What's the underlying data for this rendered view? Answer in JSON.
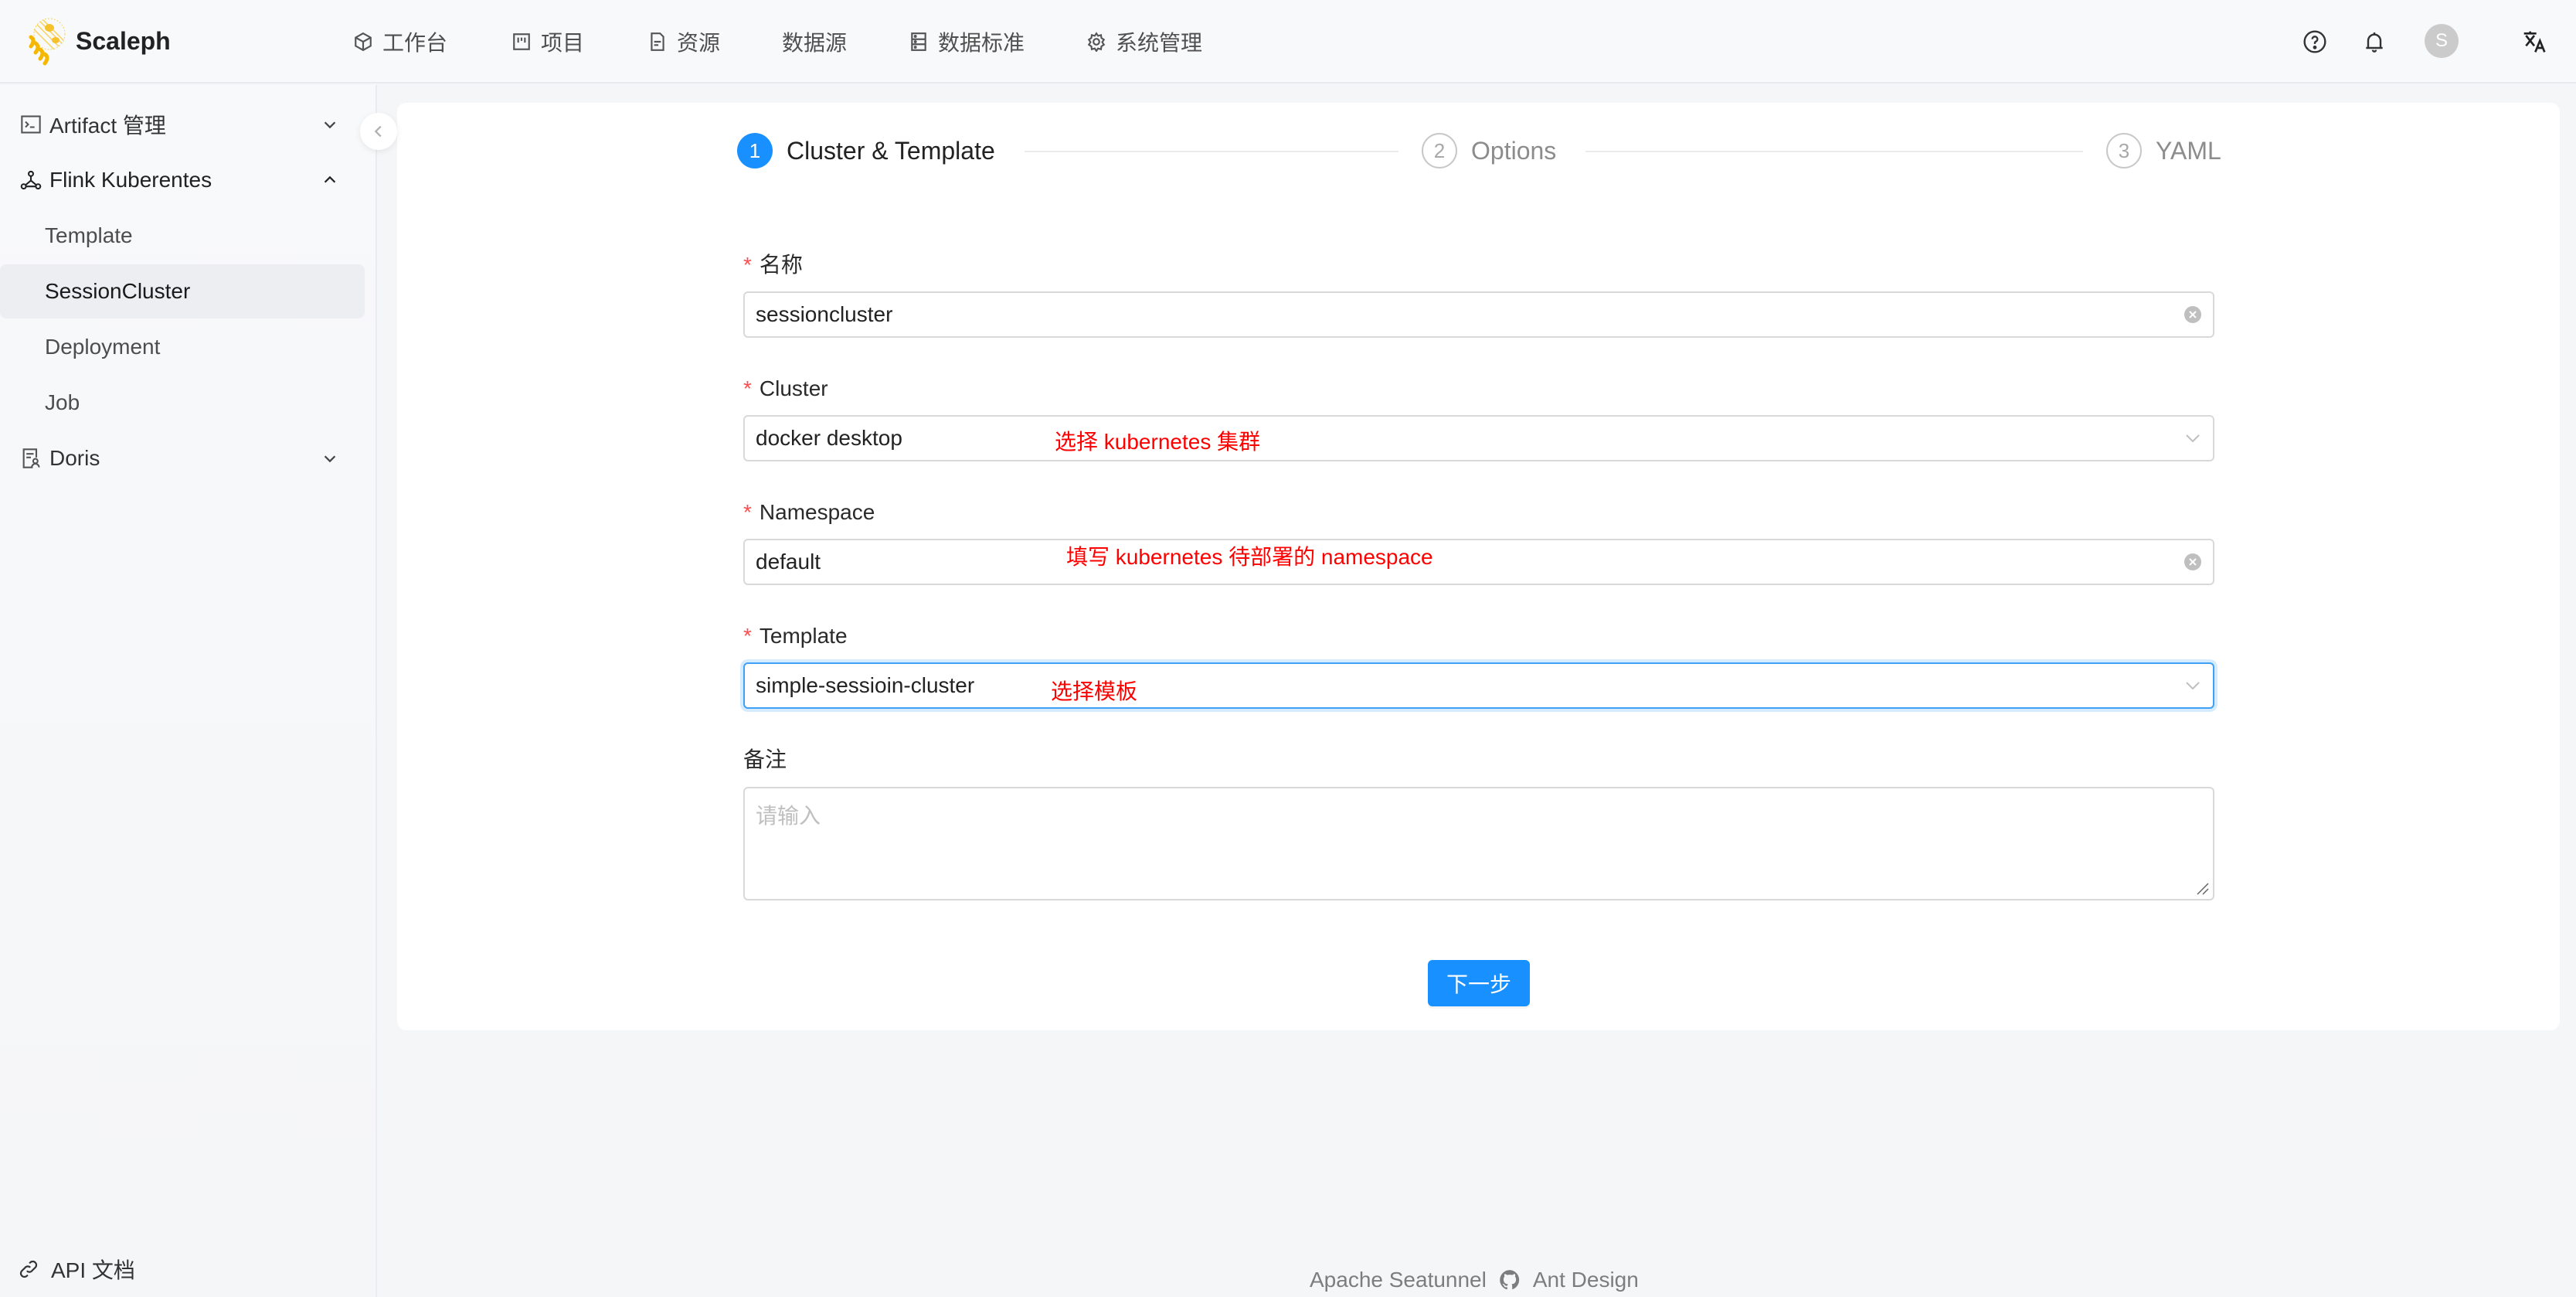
{
  "app": {
    "brand": "Scaleph"
  },
  "header": {
    "nav": [
      {
        "label": "工作台",
        "icon": "cube-icon"
      },
      {
        "label": "项目",
        "icon": "project-icon"
      },
      {
        "label": "资源",
        "icon": "file-icon"
      },
      {
        "label": "数据源",
        "icon": ""
      },
      {
        "label": "数据标准",
        "icon": "database-icon"
      },
      {
        "label": "系统管理",
        "icon": "gear-icon"
      }
    ],
    "avatar_initial": "S",
    "icons": [
      "help-icon",
      "bell-icon",
      "translate-icon"
    ]
  },
  "sidebar": {
    "items": [
      {
        "label": "Artifact 管理",
        "expanded": false
      },
      {
        "label": "Flink Kuberentes",
        "expanded": true,
        "children": [
          {
            "label": "Template",
            "selected": false
          },
          {
            "label": "SessionCluster",
            "selected": true
          },
          {
            "label": "Deployment",
            "selected": false
          },
          {
            "label": "Job",
            "selected": false
          }
        ]
      },
      {
        "label": "Doris",
        "expanded": false
      }
    ],
    "api_doc": "API 文档"
  },
  "steps": [
    {
      "num": "1",
      "title": "Cluster & Template",
      "status": "process"
    },
    {
      "num": "2",
      "title": "Options",
      "status": "wait"
    },
    {
      "num": "3",
      "title": "YAML",
      "status": "wait"
    }
  ],
  "form": {
    "name": {
      "label": "名称",
      "required": true,
      "value": "sessioncluster"
    },
    "cluster": {
      "label": "Cluster",
      "required": true,
      "value": "docker desktop",
      "annotation": "选择 kubernetes 集群"
    },
    "namespace": {
      "label": "Namespace",
      "required": true,
      "value": "default",
      "annotation": "填写 kubernetes 待部署的 namespace"
    },
    "template": {
      "label": "Template",
      "required": true,
      "value": "simple-sessioin-cluster",
      "annotation": "选择模板"
    },
    "remark": {
      "label": "备注",
      "placeholder": "请输入",
      "value": ""
    },
    "required_mark": "*",
    "next_button": "下一步"
  },
  "footer": {
    "left": "Apache Seatunnel",
    "right": "Ant Design"
  },
  "colors": {
    "primary": "#1890ff",
    "annotation": "#ff0000",
    "required": "#ff4d4f"
  }
}
